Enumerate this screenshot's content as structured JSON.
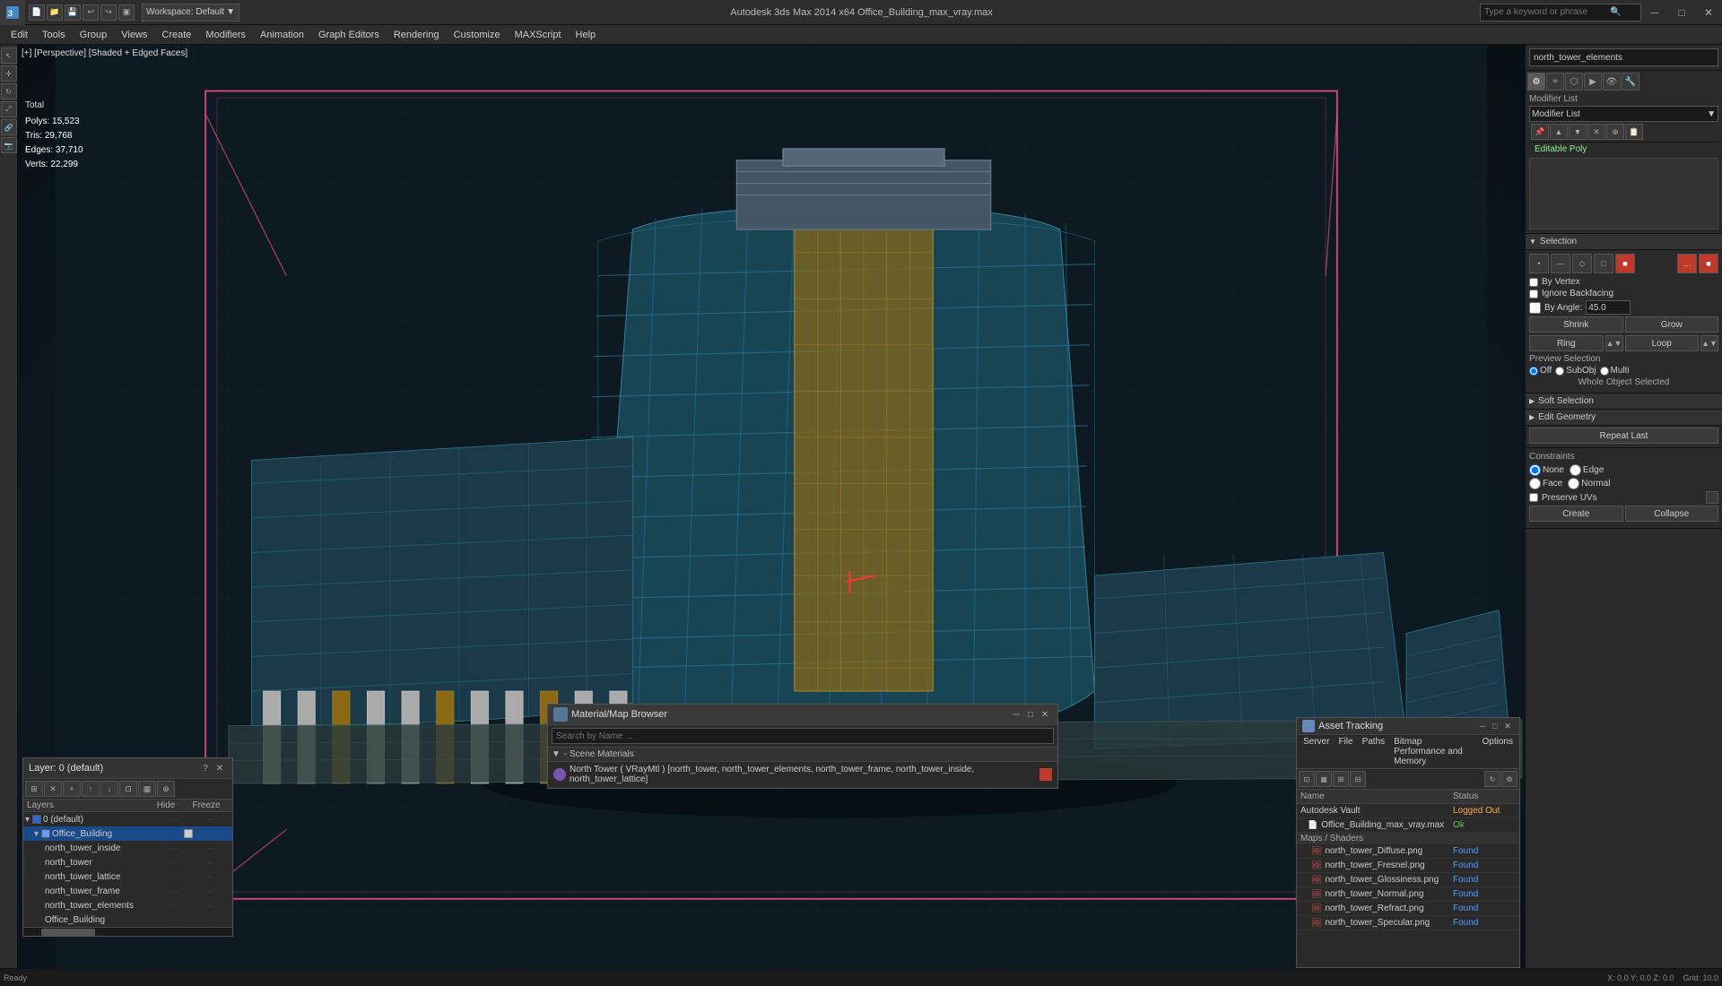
{
  "titlebar": {
    "app_icon": "3ds",
    "workspace": "Workspace: Default",
    "title": "Autodesk 3ds Max 2014 x64      Office_Building_max_vray.max",
    "search_placeholder": "Type a keyword or phrase",
    "minimize": "─",
    "maximize": "□",
    "close": "✕"
  },
  "menubar": {
    "items": [
      "Edit",
      "Tools",
      "Group",
      "Views",
      "Create",
      "Modifiers",
      "Animation",
      "Graph Editors",
      "Rendering",
      "Customize",
      "MAXScript",
      "Help"
    ]
  },
  "viewport": {
    "label": "[+] [Perspective] [Shaded + Edged Faces]",
    "stats": {
      "total_label": "Total",
      "polys_label": "Polys:",
      "polys_value": "15,523",
      "tris_label": "Tris:",
      "tris_value": "29,768",
      "edges_label": "Edges:",
      "edges_value": "37,710",
      "verts_label": "Verts:",
      "verts_value": "22,299"
    }
  },
  "right_panel": {
    "name_value": "north_tower_elements",
    "tabs": [
      "pin",
      "box",
      "light",
      "cam",
      "helper",
      "space"
    ],
    "modifier_list_label": "Modifier List",
    "modifier_item": "Editable Poly",
    "panel_buttons": [
      "▼",
      "▲",
      "✕",
      "⊕",
      "✎"
    ],
    "selection_section": "Selection",
    "sel_icons": [
      "•",
      "—",
      "◇",
      "□",
      "■"
    ],
    "by_vertex_label": "By Vertex",
    "ignore_backfacing_label": "Ignore Backfacing",
    "by_angle_label": "By Angle:",
    "by_angle_value": "45.0",
    "shrink_label": "Shrink",
    "grow_label": "Grow",
    "ring_label": "Ring",
    "loop_label": "Loop",
    "preview_selection_label": "Preview Selection",
    "off_label": "Off",
    "subcobj_label": "SubObj",
    "multi_label": "Multi",
    "whole_object_label": "Whole Object Selected",
    "soft_selection_label": "Soft Selection",
    "edit_geometry_label": "Edit Geometry",
    "repeat_last_label": "Repeat Last",
    "constraints_label": "Constraints",
    "none_label": "None",
    "edge_label": "Edge",
    "face_label": "Face",
    "normal_label": "Normal",
    "preserve_uvs_label": "Preserve UVs",
    "create_label": "Create",
    "collapse_label": "Collapse"
  },
  "layer_panel": {
    "title": "Layer: 0 (default)",
    "help": "?",
    "close": "✕",
    "toolbar_buttons": [
      "⊞",
      "✕",
      "+",
      "↑",
      "↓",
      "⊡",
      "▦",
      "⊕"
    ],
    "col_layers": "Layers",
    "col_hide": "Hide",
    "col_freeze": "Freeze",
    "rows": [
      {
        "indent": 0,
        "expand": "▼",
        "name": "0 (default)",
        "color": "#3366cc",
        "dots": "···",
        "selected": false
      },
      {
        "indent": 1,
        "expand": "▼",
        "name": "Office_Building",
        "color": "#6699ff",
        "dots": "···",
        "selected": true
      },
      {
        "indent": 2,
        "expand": "",
        "name": "north_tower_inside",
        "color": "",
        "dots": "···",
        "selected": false
      },
      {
        "indent": 2,
        "expand": "",
        "name": "north_tower",
        "color": "",
        "dots": "···",
        "selected": false
      },
      {
        "indent": 2,
        "expand": "",
        "name": "north_tower_lattice",
        "color": "",
        "dots": "···",
        "selected": false
      },
      {
        "indent": 2,
        "expand": "",
        "name": "north_tower_frame",
        "color": "",
        "dots": "···",
        "selected": false
      },
      {
        "indent": 2,
        "expand": "",
        "name": "north_tower_elements",
        "color": "",
        "dots": "···",
        "selected": false
      },
      {
        "indent": 2,
        "expand": "",
        "name": "Office_Building",
        "color": "",
        "dots": "···",
        "selected": false
      }
    ]
  },
  "material_browser": {
    "title": "Material/Map Browser",
    "close": "✕",
    "search_placeholder": "Search by Name ...",
    "scene_materials_label": "- Scene Materials",
    "item": {
      "icon_color": "#7755aa",
      "text": "North Tower ( VRayMtl ) [north_tower, north_tower_elements, north_tower_frame, north_tower_inside, north_tower_lattice]",
      "swatch_color": "#c0392b"
    }
  },
  "asset_panel": {
    "title": "Asset Tracking",
    "menu_items": [
      "Server",
      "File",
      "Paths",
      "Bitmap Performance and Memory",
      "Options"
    ],
    "col_name": "Name",
    "col_status": "Status",
    "rows": [
      {
        "indent": 0,
        "name": "Autodesk Vault",
        "status": "Logged Out",
        "status_class": "logged"
      },
      {
        "indent": 1,
        "name": "Office_Building_max_vray.max",
        "status": "Ok",
        "status_class": "ok"
      },
      {
        "indent": 1,
        "name": "Maps / Shaders",
        "status": "",
        "status_class": "",
        "is_section": true
      },
      {
        "indent": 2,
        "name": "north_tower_Diffuse.png",
        "status": "Found",
        "status_class": "found"
      },
      {
        "indent": 2,
        "name": "north_tower_Fresnel.png",
        "status": "Found",
        "status_class": "found"
      },
      {
        "indent": 2,
        "name": "north_tower_Glossiness.png",
        "status": "Found",
        "status_class": "found"
      },
      {
        "indent": 2,
        "name": "north_tower_Normal.png",
        "status": "Found",
        "status_class": "found"
      },
      {
        "indent": 2,
        "name": "north_tower_Refract.png",
        "status": "Found",
        "status_class": "found"
      },
      {
        "indent": 2,
        "name": "north_tower_Specular.png",
        "status": "Found",
        "status_class": "found"
      }
    ]
  }
}
